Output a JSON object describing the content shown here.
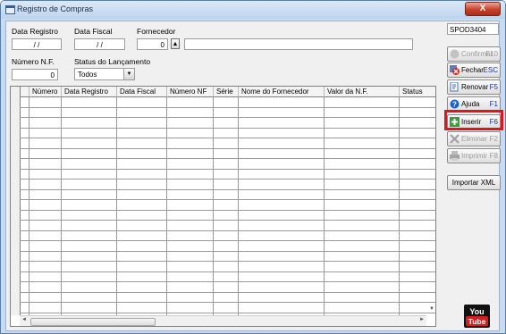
{
  "window": {
    "title": "Registro de Compras",
    "close_label": "X"
  },
  "form": {
    "data_registro_label": "Data Registro",
    "data_registro_value": "/ /",
    "data_fiscal_label": "Data Fiscal",
    "data_fiscal_value": "/ /",
    "fornecedor_label": "Fornecedor",
    "fornecedor_code": "0",
    "fornecedor_name": "",
    "numero_nf_label": "Número N.F.",
    "numero_nf_value": "0",
    "status_label": "Status do Lançamento",
    "status_value": "Todos"
  },
  "grid": {
    "columns": [
      "Número",
      "Data Registro",
      "Data Fiscal",
      "Número NF",
      "Série",
      "Nome do Fornecedor",
      "Valor da N.F.",
      "Status"
    ],
    "rows": []
  },
  "side": {
    "code": "SPOD3404",
    "buttons": [
      {
        "label": "Confirmar",
        "key": "F10",
        "icon": "confirm-icon",
        "enabled": false
      },
      {
        "label": "Fechar",
        "key": "ESC",
        "icon": "close-x-icon",
        "enabled": true
      },
      {
        "label": "Renovar",
        "key": "F5",
        "icon": "refresh-icon",
        "enabled": true
      },
      {
        "label": "Ajuda",
        "key": "F1",
        "icon": "help-icon",
        "enabled": true
      },
      {
        "label": "Inserir",
        "key": "F6",
        "icon": "add-icon",
        "enabled": true
      },
      {
        "label": "Eliminar",
        "key": "F2",
        "icon": "delete-icon",
        "enabled": false
      },
      {
        "label": "Imprimir",
        "key": "F8",
        "icon": "printer-icon",
        "enabled": false
      }
    ],
    "import_xml_label": "Importar XML",
    "youtube_top": "You",
    "youtube_bottom": "Tube"
  },
  "colors": {
    "highlight": "#e2141c",
    "key_text": "#1530a8"
  }
}
